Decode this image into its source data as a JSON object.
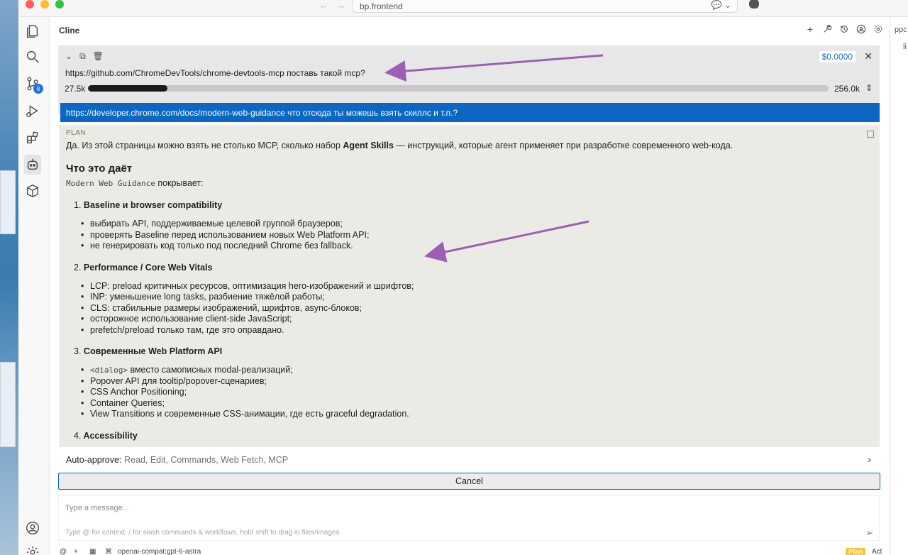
{
  "window": {
    "url": "bp.frontend"
  },
  "panel": {
    "title": "Cline"
  },
  "task": {
    "text": "https://github.com/ChromeDevTools/chrome-devtools-mcp поставь такой mcp?",
    "cost": "$0.0000",
    "context_used": "27.5k",
    "context_max": "256.0k",
    "context_fraction": 0.107
  },
  "user_message": "https://developer.chrome.com/docs/modern-web-guidance что отсюда ты можешь взять скиллс и т.п.?",
  "plan": {
    "tag": "PLAN",
    "intro_before": "Да. Из этой страницы можно взять не столько MCP, сколько набор ",
    "intro_bold": "Agent Skills",
    "intro_after": " — инструкций, которые агент применяет при разработке современного web-кода.",
    "heading": "Что это даёт",
    "covers_code": "Modern Web Guidance",
    "covers_text": " покрывает:",
    "sections": [
      {
        "num": "1.",
        "title": "Baseline и browser compatibility",
        "items": [
          "выбирать API, поддерживаемые целевой группой браузеров;",
          "проверять Baseline перед использованием новых Web Platform API;",
          "не генерировать код только под последний Chrome без fallback."
        ]
      },
      {
        "num": "2.",
        "title": "Performance / Core Web Vitals",
        "items": [
          "LCP: preload критичных ресурсов, оптимизация hero-изображений и шрифтов;",
          "INP: уменьшение long tasks, разбиение тяжёлой работы;",
          "CLS: стабильные размеры изображений, шрифтов, async-блоков;",
          "осторожное использование client-side JavaScript;",
          "prefetch/preload только там, где это оправдано."
        ]
      },
      {
        "num": "3.",
        "title": "Современные Web Platform API",
        "code_item": "<dialog>",
        "code_item_text": " вместо самописных modal-реализаций;",
        "items": [
          "Popover API для tooltip/popover-сценариев;",
          "CSS Anchor Positioning;",
          "Container Queries;",
          "View Transitions и современные CSS-анимации, где есть graceful degradation."
        ]
      },
      {
        "num": "4.",
        "title": "Accessibility",
        "items": []
      }
    ]
  },
  "auto_approve": {
    "label": "Auto-approve:",
    "items": "Read, Edit, Commands, Web Fetch, MCP"
  },
  "cancel_label": "Cancel",
  "input": {
    "placeholder": "Type a message...",
    "hint": "Type @ for context, / for slash commands & workflows, hold shift to drag in files/images"
  },
  "bottom": {
    "model": "openai-compat:gpt-6-astra",
    "plan_label": "Plan",
    "act_label": "Act"
  },
  "activity_badge": "8",
  "right_edge": {
    "text1": "ppc",
    "text2": "li"
  },
  "colors": {
    "accent": "#0b67c2",
    "plan_bg": "#ebebe6",
    "arrow": "#9b5fb5"
  }
}
